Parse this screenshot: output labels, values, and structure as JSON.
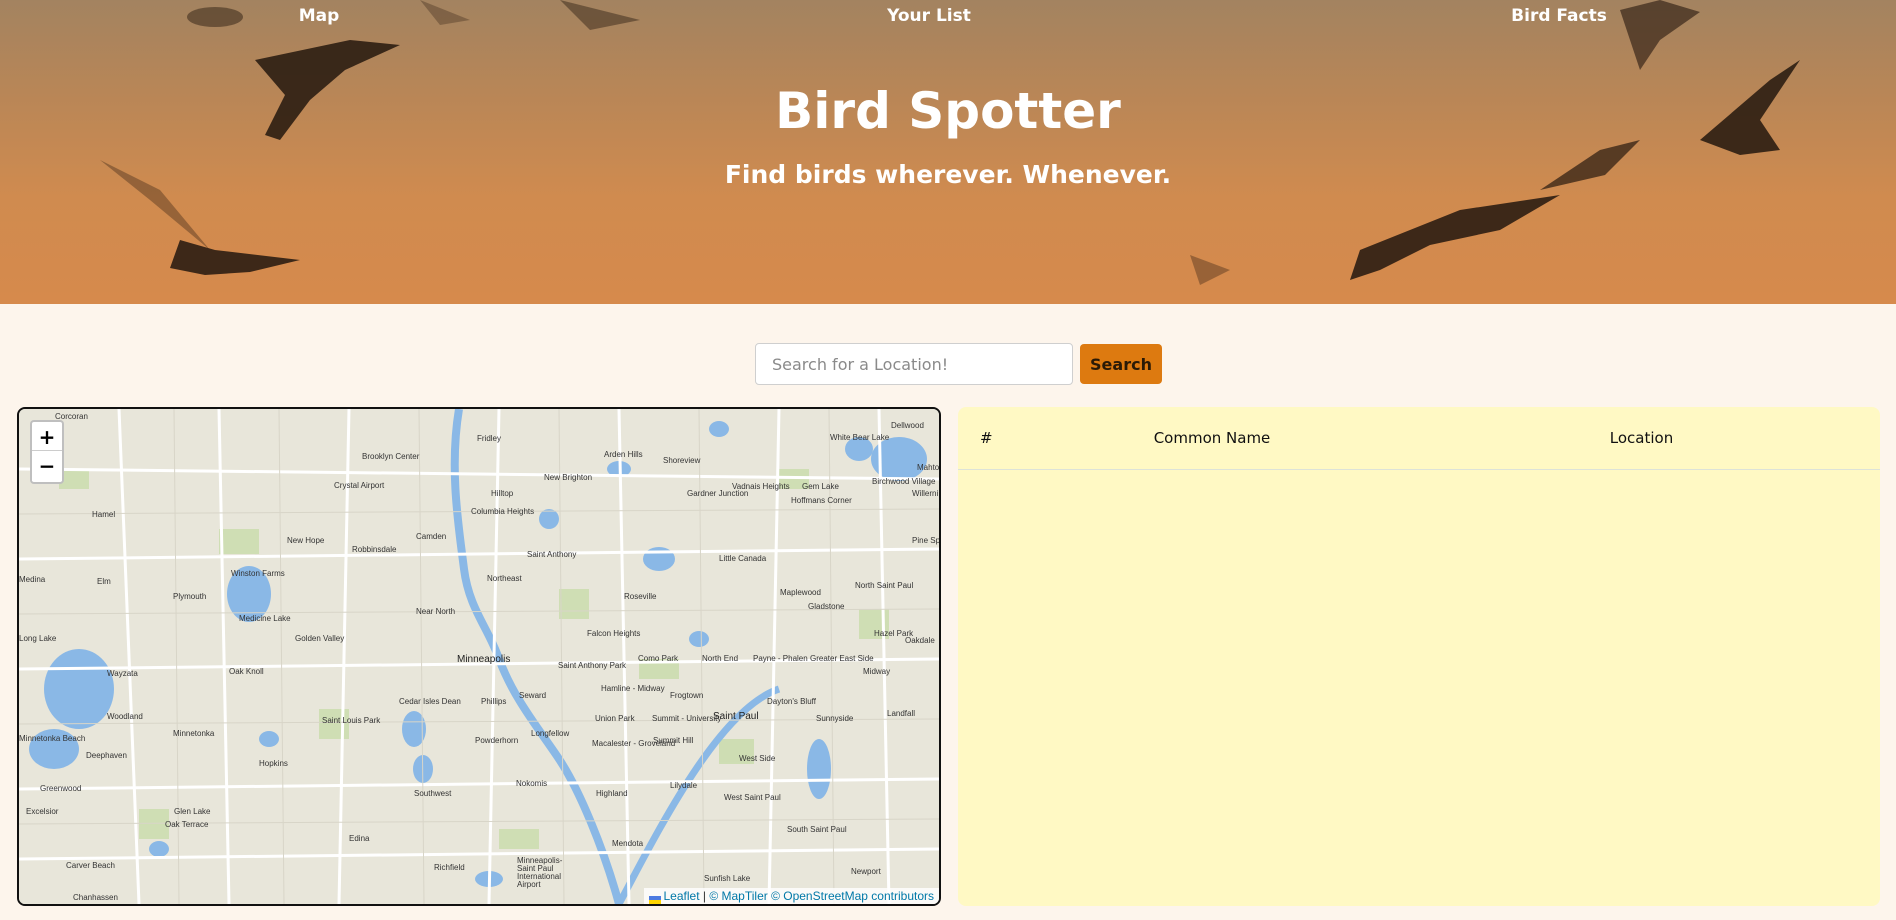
{
  "nav": {
    "map": "Map",
    "your_list": "Your List",
    "bird_facts": "Bird Facts"
  },
  "hero": {
    "title": "Bird Spotter",
    "subtitle": "Find birds wherever. Whenever."
  },
  "search": {
    "placeholder": "Search for a Location!",
    "button": "Search"
  },
  "map": {
    "zoom_in": "+",
    "zoom_out": "−",
    "attribution": {
      "leaflet": "Leaflet",
      "separator": " | ",
      "maptiler": "© MapTiler",
      "osm": "© OpenStreetMap contributors"
    },
    "places": {
      "corcoran": "Corcoran",
      "fridley": "Fridley",
      "brooklyn_center": "Brooklyn Center",
      "arden_hills": "Arden Hills",
      "shoreview": "Shoreview",
      "white_bear_lake": "White Bear Lake",
      "dellwood": "Dellwood",
      "mahtomedi": "Mahto",
      "new_brighton": "New Brighton",
      "crystal_airport": "Crystal Airport",
      "hilltop": "Hilltop",
      "vadnais_heights": "Vadnais Heights",
      "gem_lake": "Gem Lake",
      "birchwood_village": "Birchwood Village",
      "willernie": "Willerni",
      "gardner_junction": "Gardner Junction",
      "hoffmans_corner": "Hoffmans Corner",
      "hamel": "Hamel",
      "columbia_heights": "Columbia Heights",
      "new_hope": "New Hope",
      "camden": "Camden",
      "robbinsdale": "Robbinsdale",
      "pine_springs": "Pine Spr",
      "saint_anthony": "Saint Anthony",
      "little_canada": "Little Canada",
      "medina": "Medina",
      "winston_farms": "Winston Farms",
      "northeast": "Northeast",
      "north_saint_paul": "North Saint Paul",
      "plymouth": "Plymouth",
      "elm": "Elm",
      "roseville": "Roseville",
      "maplewood": "Maplewood",
      "gladstone": "Gladstone",
      "medicine_lake": "Medicine Lake",
      "near_north": "Near North",
      "falcon_heights": "Falcon Heights",
      "hazel_park": "Hazel Park",
      "oakdale": "Oakdale",
      "golden_valley": "Golden Valley",
      "long_lake": "Long Lake",
      "minneapolis": "Minneapolis",
      "como_park": "Como Park",
      "north_end": "North End",
      "payne_phalen": "Payne - Phalen",
      "greater_east_side": "Greater East Side",
      "saint_anthony_park": "Saint Anthony Park",
      "wayzata": "Wayzata",
      "oak_knoll": "Oak Knoll",
      "midway": "Midway",
      "cedar_isles_dean": "Cedar Isles Dean",
      "seward": "Seward",
      "hamline_midway": "Hamline - Midway",
      "frogtown": "Frogtown",
      "daytons_bluff": "Dayton's Bluff",
      "phillips": "Phillips",
      "woodland": "Woodland",
      "saint_louis_park": "Saint Louis Park",
      "saint_paul": "Saint Paul",
      "minnetonka": "Minnetonka",
      "union_park": "Union Park",
      "summit_university": "Summit - University",
      "sunnyside": "Sunnyside",
      "landfall": "Landfall",
      "longfellow": "Longfellow",
      "minnetonka_beach": "Minnetonka Beach",
      "powderhorn": "Powderhorn",
      "deephaven": "Deephaven",
      "macalester_groveland": "Macalester - Groveland",
      "summit_hill": "Summit Hill",
      "west_side": "West Side",
      "hopkins": "Hopkins",
      "nokomis": "Nokomis",
      "greenwood": "Greenwood",
      "lilydale": "Lilydale",
      "highland": "Highland",
      "southwest": "Southwest",
      "west_saint_paul": "West Saint Paul",
      "glen_lake": "Glen Lake",
      "excelsior": "Excelsior",
      "oak_terrace": "Oak Terrace",
      "south_saint_paul": "South Saint Paul",
      "edina": "Edina",
      "mendota": "Mendota",
      "carver_beach": "Carver Beach",
      "richfield": "Richfield",
      "minneapolis_saint_paul_airport": "Minneapolis-Saint Paul International Airport",
      "newport": "Newport",
      "sunfish_lake": "Sunfish Lake",
      "chanhassen": "Chanhassen"
    }
  },
  "table": {
    "headers": [
      "#",
      "Common Name",
      "Location"
    ]
  },
  "colors": {
    "accent": "#dd7a10",
    "page_bg": "#fdf5ec",
    "panel_bg": "#fff9c4"
  }
}
